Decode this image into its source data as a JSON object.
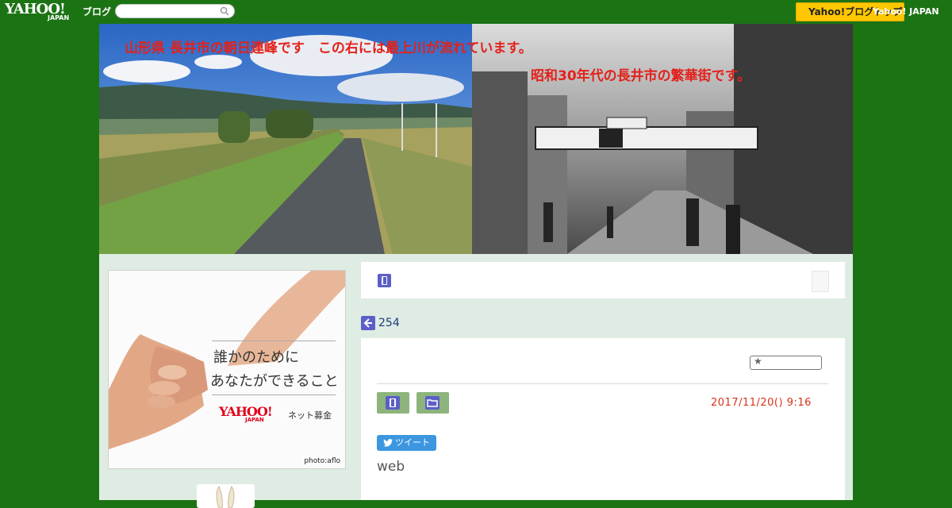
{
  "header": {
    "logo_text": "YAHOO!",
    "logo_sub": "JAPAN",
    "blog_label": "ブログ",
    "search_placeholder": "",
    "yahoo_button": "Yahoo!ブログトップ",
    "yahoo_link": "Yahoo! JAPAN"
  },
  "banner": {
    "caption_left": "山形県 長井市の朝日連峰です　この右には最上川が流れています。",
    "caption_right": "昭和30年代の長井市の繁華街です。"
  },
  "sidebar_ad": {
    "line1": "誰かのために",
    "line2": "あなたができること",
    "logo": "YAHOO!",
    "logo_sub": "JAPAN",
    "service": "ネット募金",
    "credit": "photo:aflo"
  },
  "category_bar": {
    "icon": "book-icon"
  },
  "back_nav": {
    "count": "254"
  },
  "post": {
    "date": "2017/11/20()  9:16",
    "tweet_label": "ツイート",
    "body": "web"
  },
  "colors": {
    "header_green": "#1c7314",
    "page_bg": "#dfece3",
    "icon_purple": "#5b5fc7",
    "button_green": "#8db47c",
    "date_red": "#d9321a",
    "tweet_blue": "#3c97e0",
    "caption_red": "#e3211b"
  }
}
